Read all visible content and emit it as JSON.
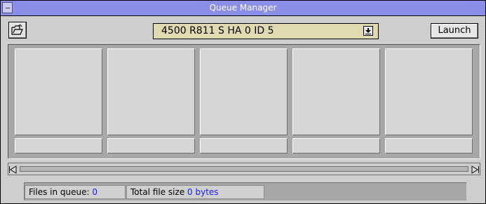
{
  "window": {
    "title": "Queue Manager"
  },
  "toolbar": {
    "open_icon": "open-folder-icon",
    "preset_value": "4500 R811 S HA 0 ID 5",
    "launch_label": "Launch"
  },
  "queue": {
    "slots": [
      {
        "label": ""
      },
      {
        "label": ""
      },
      {
        "label": ""
      },
      {
        "label": ""
      },
      {
        "label": ""
      }
    ]
  },
  "status": {
    "files_label": "Files in queue:",
    "files_value": "0",
    "size_label": "Total file size",
    "size_value": "0 bytes"
  },
  "colors": {
    "titlebar": "#8a8ee6",
    "dropdown_bg": "#e0dab0",
    "status_value": "#1a1aff"
  }
}
